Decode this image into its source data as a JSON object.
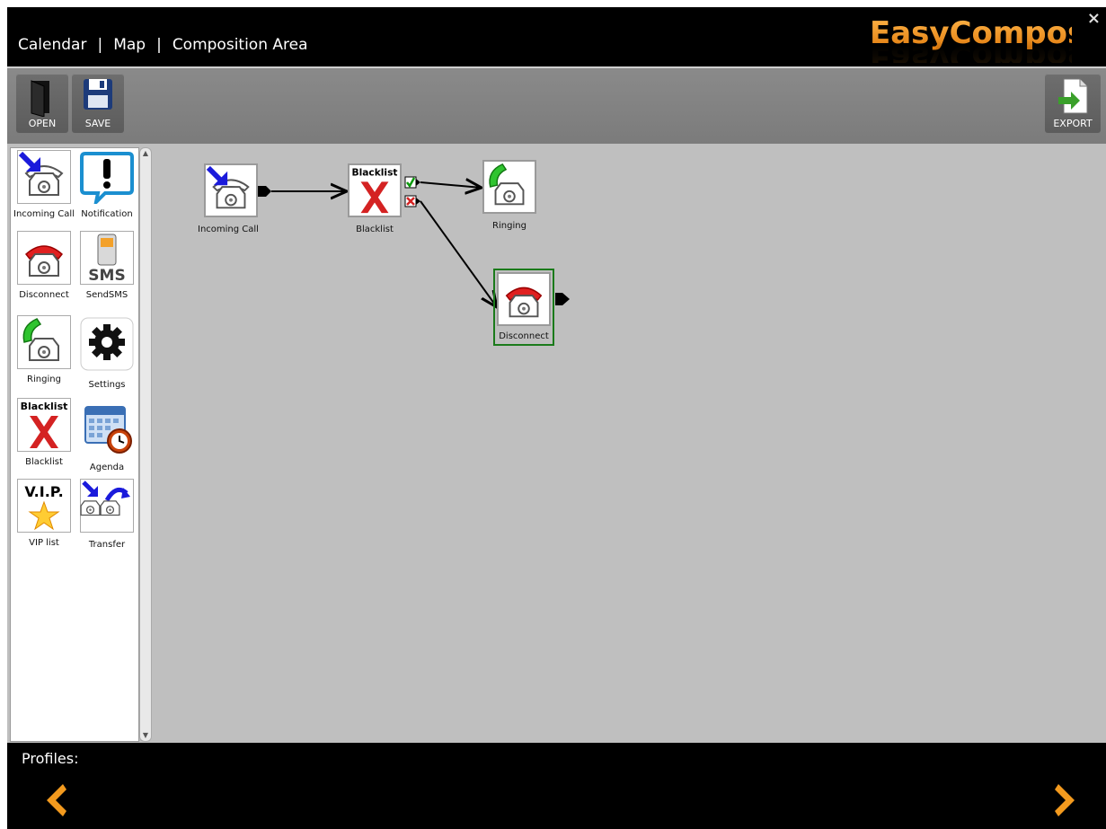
{
  "header": {
    "tabs": [
      {
        "label": "Calendar"
      },
      {
        "label": "Map"
      },
      {
        "label": "Composition Area"
      }
    ],
    "separator": "|",
    "logo_text": "EasyComposer",
    "close_label": "×"
  },
  "toolbar": {
    "open_label": "OPEN",
    "save_label": "SAVE",
    "export_label": "EXPORT"
  },
  "palette": {
    "items": [
      {
        "label": "Incoming Call",
        "icon": "incoming-call-icon"
      },
      {
        "label": "Notification",
        "icon": "notification-icon"
      },
      {
        "label": "Disconnect",
        "icon": "disconnect-icon"
      },
      {
        "label": "SendSMS",
        "icon": "sms-phone-icon"
      },
      {
        "label": "Ringing",
        "icon": "ringing-icon"
      },
      {
        "label": "Settings",
        "icon": "gear-icon"
      },
      {
        "label": "Blacklist",
        "icon": "blacklist-icon",
        "badge": "Blacklist"
      },
      {
        "label": "Agenda",
        "icon": "agenda-icon"
      },
      {
        "label": "VIP list",
        "icon": "vip-icon",
        "badge": "V.I.P."
      },
      {
        "label": "Transfer",
        "icon": "transfer-icon"
      }
    ],
    "sms_text": "SMS"
  },
  "canvas": {
    "nodes": [
      {
        "label": "Incoming Call",
        "icon": "incoming-call-icon"
      },
      {
        "label": "Blacklist",
        "icon": "blacklist-icon",
        "badge": "Blacklist"
      },
      {
        "label": "Ringing",
        "icon": "ringing-icon"
      },
      {
        "label": "Disconnect",
        "icon": "disconnect-icon",
        "selected": true
      }
    ]
  },
  "footer": {
    "profiles_label": "Profiles:"
  },
  "colors": {
    "accent": "#f39a1e",
    "selected_border": "#1a7a1a",
    "canvas_bg": "#bfbfbf"
  }
}
